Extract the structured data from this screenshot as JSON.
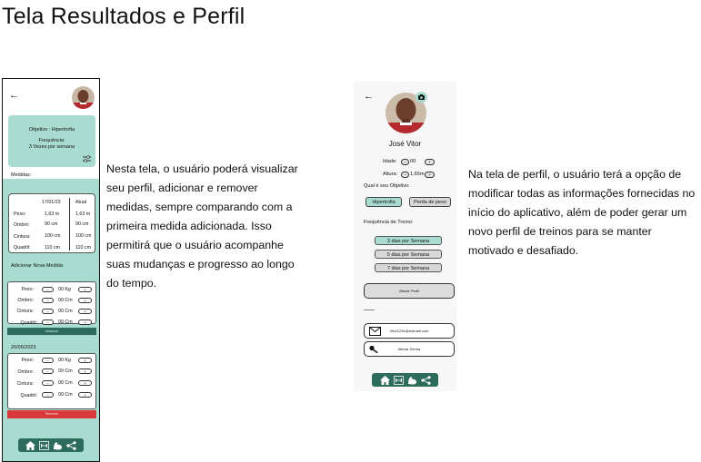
{
  "page_title": "Tela Resultados e Perfil",
  "colors": {
    "teal": "#a9dcd1",
    "dark_teal": "#2d6b5d",
    "red": "#d9393b"
  },
  "left_screen": {
    "back_icon": "arrow-left-icon",
    "goal_card": {
      "objective": "Objetivo : Hipertrofia",
      "frequency_label": "Frequência:",
      "frequency_value": "3 Vezes por semana",
      "settings_icon": "sliders-icon"
    },
    "measures_label": "Medidas:",
    "measures_table": {
      "headers": [
        "17/01/23",
        "Atual"
      ],
      "rows": [
        {
          "label": "Peso:",
          "first": "1,63 m",
          "current": "1,63 m"
        },
        {
          "label": "Ombro:",
          "first": "90  cm",
          "current": "90  cm"
        },
        {
          "label": "Cintura:",
          "first": "100 cm",
          "current": "100 cm"
        },
        {
          "label": "Quadril:",
          "first": "110 cm",
          "current": "110 cm"
        }
      ]
    },
    "add_label": "Adicionar Nova Medida:",
    "add_rows": [
      {
        "label": "Peso:",
        "minus": "−",
        "value": "00",
        "unit": "Kg",
        "plus": "+"
      },
      {
        "label": "Ombro:",
        "minus": "−",
        "value": "00",
        "unit": "Cm",
        "plus": "+"
      },
      {
        "label": "Cintura:",
        "minus": "−",
        "value": "00",
        "unit": "Cm",
        "plus": "+"
      },
      {
        "label": "Quadril:",
        "minus": "−",
        "value": "00",
        "unit": "Cm",
        "plus": "+"
      }
    ],
    "add_button": "Adicionar",
    "history_date": "20/06/2023",
    "history_rows": [
      {
        "label": "Peso:",
        "minus": "−",
        "value": "00",
        "unit": "Kg",
        "plus": "+"
      },
      {
        "label": "Ombro:",
        "minus": "−",
        "value": "00",
        "unit": "Cm",
        "plus": "+"
      },
      {
        "label": "Cintura:",
        "minus": "−",
        "value": "00",
        "unit": "Cm",
        "plus": "+"
      },
      {
        "label": "Quadril:",
        "minus": "−",
        "value": "00",
        "unit": "Cm",
        "plus": "+"
      }
    ],
    "remove_button": "Remover"
  },
  "left_description": "Nesta tela, o usuário poderá visualizar seu perfil, adicionar e remover medidas, sempre comparando com a primeira medida adicionada. Isso permitirá que o usuário acompanhe suas mudanças e progresso ao longo do tempo.",
  "right_screen": {
    "back_icon": "arrow-left-icon",
    "camera_icon": "camera-icon",
    "name": "José Vitor",
    "age_label": "Idade:",
    "age_value": "00",
    "height_label": "Altura:",
    "height_value": "1,65m",
    "goal_label": "Qual é seu Objetivo:",
    "goal_options": [
      "Hipertrofia",
      "Perda de peso"
    ],
    "goal_selected": "Hipertrofia",
    "freq_label": "Frequência de Treino:",
    "freq_options": [
      "3 dias por Semana",
      "5 dias por Semana",
      "7 dias por Semana"
    ],
    "freq_selected": "3 dias por Semana",
    "change_profile_button": "Alterar Perfil",
    "email_value": "Vitor123e@hotmail.com",
    "change_password_button": "Alterar Senha"
  },
  "right_description": "Na tela de perfil, o usuário terá a opção de modificar todas as informações fornecidas no início do aplicativo, além de poder gerar um novo perfil de treinos para se manter motivado e desafiado.",
  "nav_icons": [
    "home-icon",
    "dumbbell-icon",
    "flexed-arm-icon",
    "share-icon"
  ]
}
